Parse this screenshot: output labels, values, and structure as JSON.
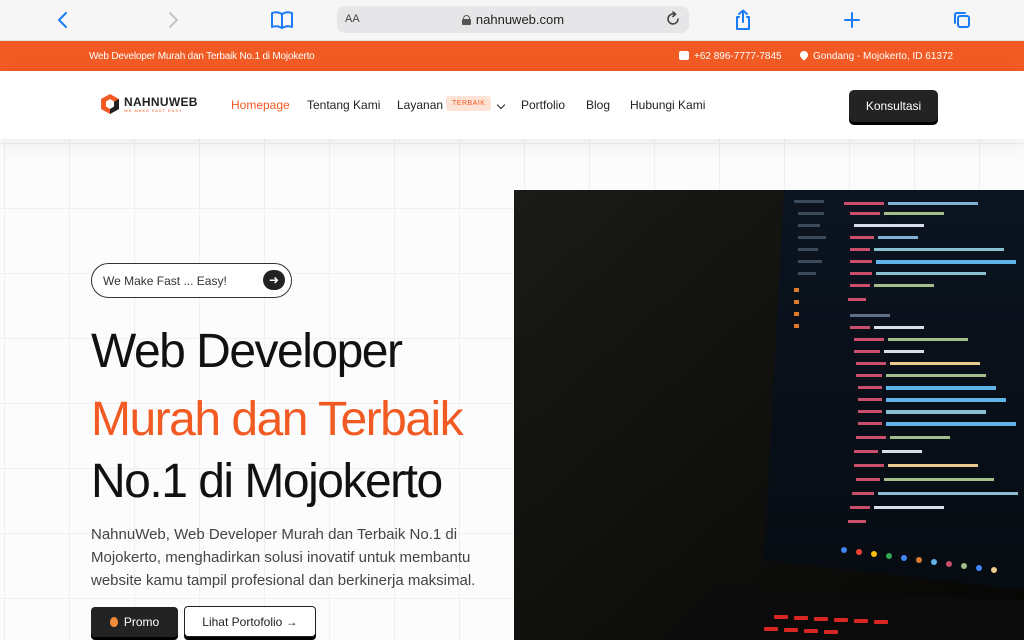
{
  "browser": {
    "text_size": "AA",
    "url": "nahnuweb.com"
  },
  "topbar": {
    "tagline": "Web Developer Murah dan Terbaik No.1 di Mojokerto",
    "phone": "+62 896-7777-7845",
    "location": "Gondang - Mojokerto, ID 61372"
  },
  "nav": {
    "logo_text": "NAHNUWEB",
    "logo_sub": "WE MAKE FAST EASY",
    "items": [
      "Homepage",
      "Tentang Kami",
      "Layanan",
      "Portfolio",
      "Blog",
      "Hubungi Kami"
    ],
    "badge": "TERBAIK",
    "cta": "Konsultasi"
  },
  "hero": {
    "pill": "We Make Fast ... Easy!",
    "heading_line1": "Web Developer",
    "heading_line2": "Murah dan Terbaik",
    "heading_line3": "No.1 di Mojokerto",
    "description": "NahnuWeb, Web Developer Murah dan Terbaik No.1 di Mojokerto, menghadirkan solusi inovatif untuk membantu website kamu tampil profesional dan berkinerja maksimal.",
    "btn_promo": "Promo",
    "btn_portfolio": "Lihat Portofolio →"
  },
  "colors": {
    "accent": "#f15a22",
    "dark": "#232323",
    "link_blue": "#1a7cf5"
  }
}
